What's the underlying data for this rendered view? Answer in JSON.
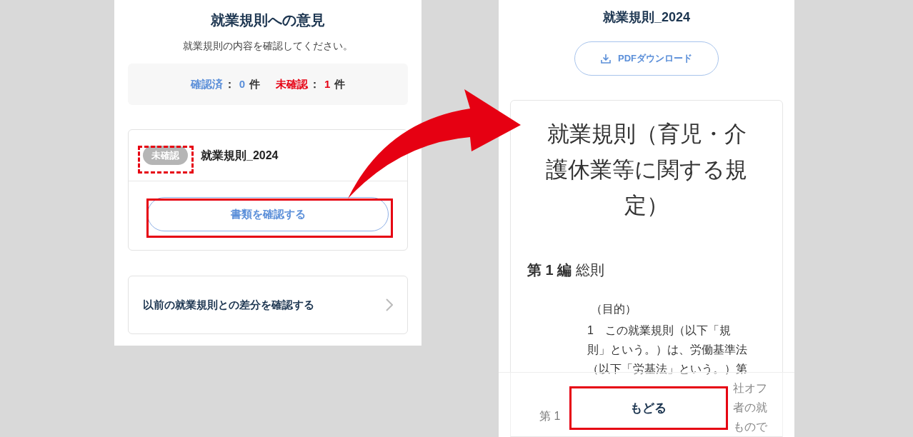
{
  "left_screen": {
    "title": "就業規則への意見",
    "subtitle": "就業規則の内容を確認してください。",
    "summary": [
      {
        "kind": "confirmed",
        "label": "確認済",
        "separator": "：",
        "count": "0",
        "unit": "件"
      },
      {
        "kind": "unconfirmed",
        "label": "未確認",
        "separator": "：",
        "count": "1",
        "unit": "件"
      }
    ],
    "documents": [
      {
        "status": "未確認",
        "name": "就業規則_2024",
        "button": "書類を確認する"
      }
    ],
    "diff_link": "以前の就業規則との差分を確認する"
  },
  "right_screen": {
    "title": "就業規則_2024",
    "download_button": "PDFダウンロード",
    "document": {
      "heading": "就業規則（育児・介護休業等に関する規定）",
      "section": "**第 1 編** 総則",
      "article_title": "（目的）",
      "lines": [
        "1　この就業規則（以下「規",
        "則」という。）は、労働基準法",
        "（以下「労基法」という。）第",
        "社オフ",
        "者の就",
        "もので"
      ],
      "hidden_fragment": "第 1"
    },
    "back_button": "もどる"
  }
}
